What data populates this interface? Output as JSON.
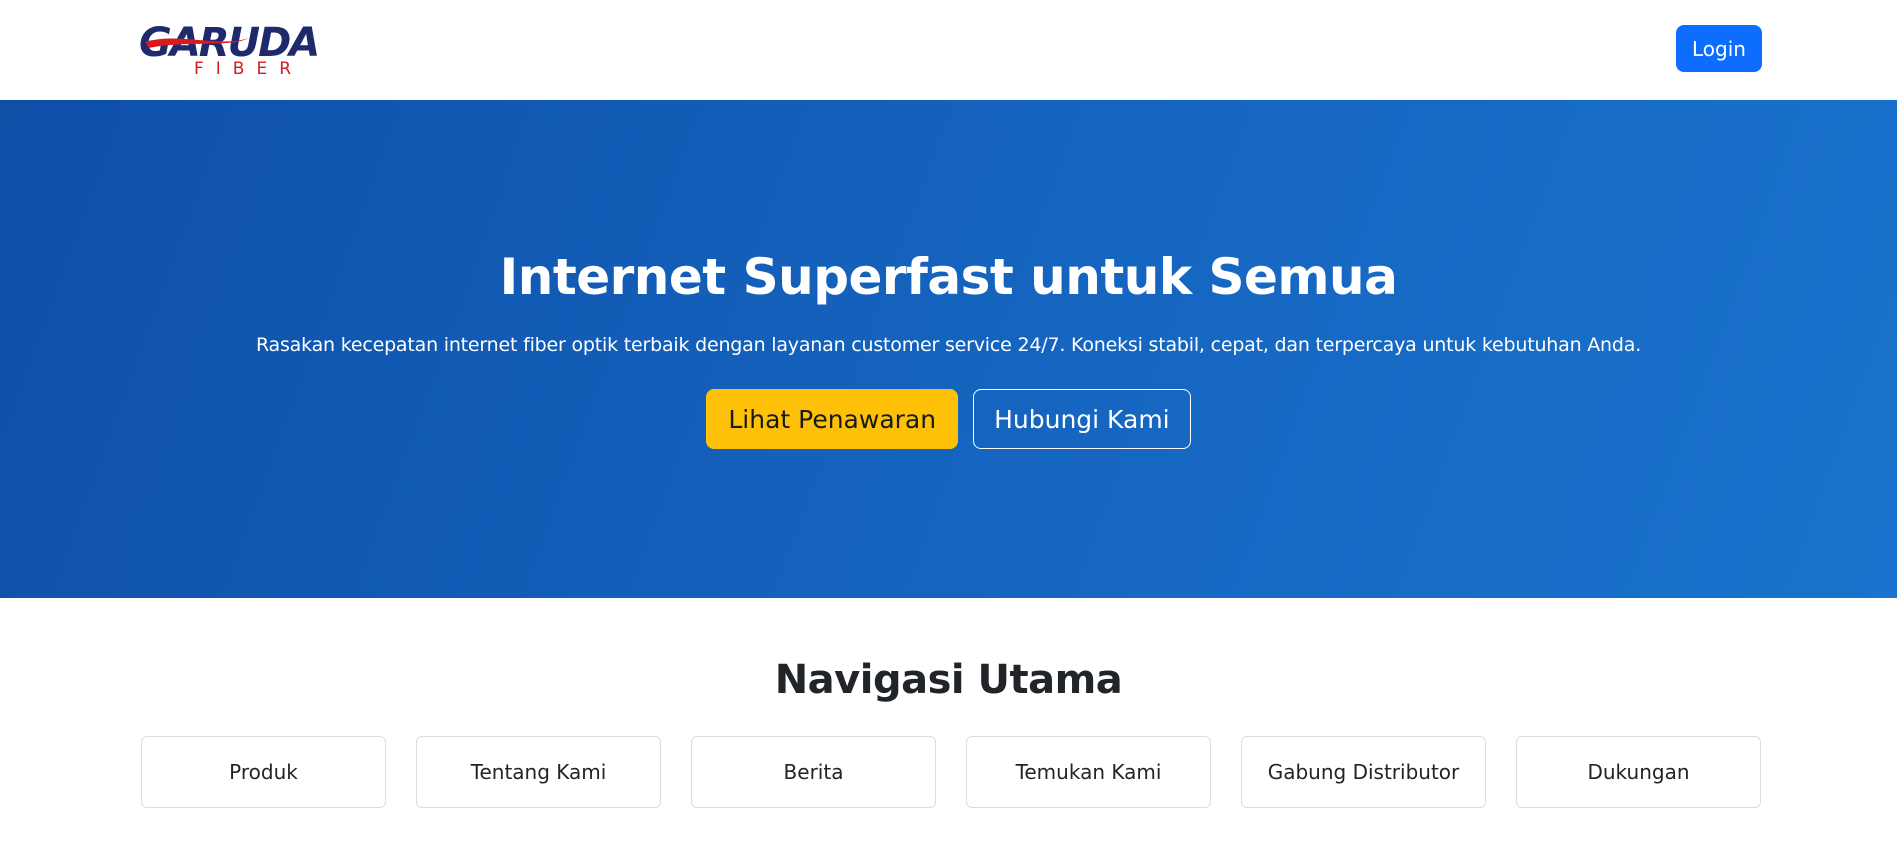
{
  "header": {
    "logo": {
      "wordmark": "GARUDA",
      "tagline": "FIBER",
      "primary_color": "#1e2a6b",
      "accent_color": "#d71920"
    },
    "login_label": "Login"
  },
  "hero": {
    "title": "Internet Superfast untuk Semua",
    "subtitle": "Rasakan kecepatan internet fiber optik terbaik dengan layanan customer service 24/7. Koneksi stabil, cepat, dan terpercaya untuk kebutuhan Anda.",
    "primary_button": "Lihat Penawaran",
    "secondary_button": "Hubungi Kami",
    "gradient_start": "#0e4fa8",
    "gradient_end": "#1a73cc"
  },
  "navigation": {
    "title": "Navigasi Utama",
    "items": [
      {
        "label": "Produk"
      },
      {
        "label": "Tentang Kami"
      },
      {
        "label": "Berita"
      },
      {
        "label": "Temukan Kami"
      },
      {
        "label": "Gabung Distributor"
      },
      {
        "label": "Dukungan"
      }
    ]
  },
  "colors": {
    "login_button": "#0d6efd",
    "primary_button": "#ffc107"
  }
}
